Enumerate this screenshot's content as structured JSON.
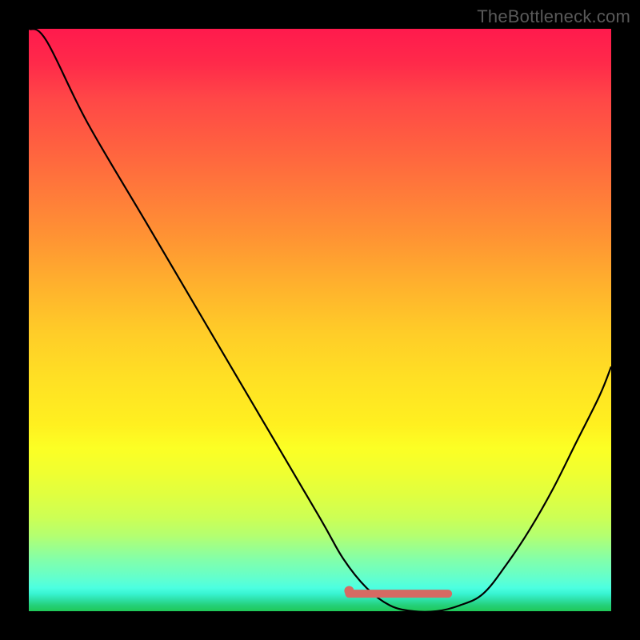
{
  "watermark": "TheBottleneck.com",
  "colors": {
    "gradient_top": "#ff1a4d",
    "gradient_bottom": "#20c858",
    "curve": "#000000",
    "marker": "#d66a63",
    "background": "#000000",
    "watermark_text": "#595959"
  },
  "chart_data": {
    "type": "line",
    "title": "",
    "xlabel": "",
    "ylabel": "",
    "xlim": [
      0,
      100
    ],
    "ylim": [
      0,
      100
    ],
    "series": [
      {
        "name": "bottleneck-curve",
        "x": [
          0,
          3,
          10,
          20,
          30,
          40,
          50,
          54,
          58,
          62,
          66,
          70,
          74,
          78,
          82,
          86,
          90,
          94,
          98,
          100
        ],
        "y": [
          100,
          98,
          84,
          67,
          50,
          33,
          16,
          9,
          4,
          1,
          0,
          0,
          1,
          3,
          8,
          14,
          21,
          29,
          37,
          42
        ]
      }
    ],
    "annotations": {
      "marker_dot": {
        "x": 55,
        "y": 3.5
      },
      "marker_bar": {
        "x_start": 55,
        "x_end": 72,
        "y": 3
      }
    }
  }
}
